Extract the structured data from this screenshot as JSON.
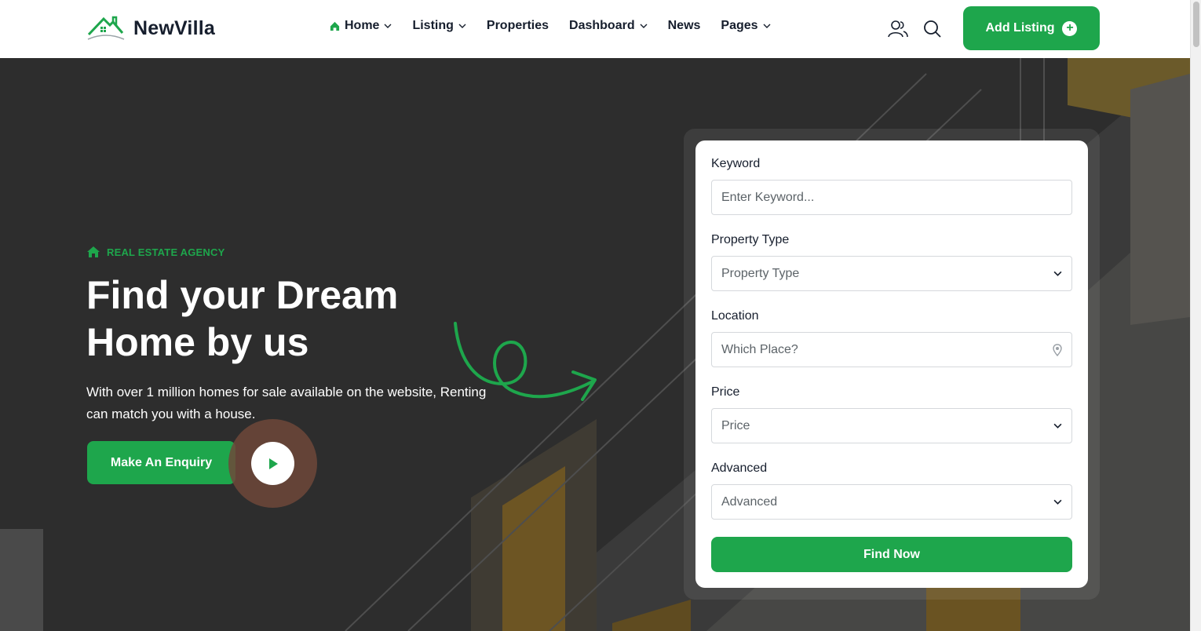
{
  "header": {
    "logo_text": "NewVilla",
    "nav": [
      {
        "label": "Home",
        "has_dropdown": true,
        "active": true
      },
      {
        "label": "Listing",
        "has_dropdown": true
      },
      {
        "label": "Properties",
        "has_dropdown": false
      },
      {
        "label": "Dashboard",
        "has_dropdown": true
      },
      {
        "label": "News",
        "has_dropdown": false
      },
      {
        "label": "Pages",
        "has_dropdown": true
      }
    ],
    "icons": [
      "user-icon",
      "search-icon"
    ],
    "add_listing_label": "Add Listing"
  },
  "hero": {
    "eyebrow": "REAL ESTATE AGENCY",
    "headline": "Find your Dream Home by us",
    "subtext": "With over 1 million homes for sale available on the website, Renting can match you with a house.",
    "enquiry_label": "Make An Enquiry"
  },
  "search_form": {
    "keyword": {
      "label": "Keyword",
      "placeholder": "Enter Keyword..."
    },
    "property_type": {
      "label": "Property Type",
      "value": "Property Type"
    },
    "location": {
      "label": "Location",
      "placeholder": "Which Place?"
    },
    "price": {
      "label": "Price",
      "value": "Price"
    },
    "advanced": {
      "label": "Advanced",
      "value": "Advanced"
    },
    "submit_label": "Find Now"
  },
  "colors": {
    "accent": "#1ea64c",
    "text_dark": "#161e2d",
    "hero_bg": "#2b2b2b"
  }
}
